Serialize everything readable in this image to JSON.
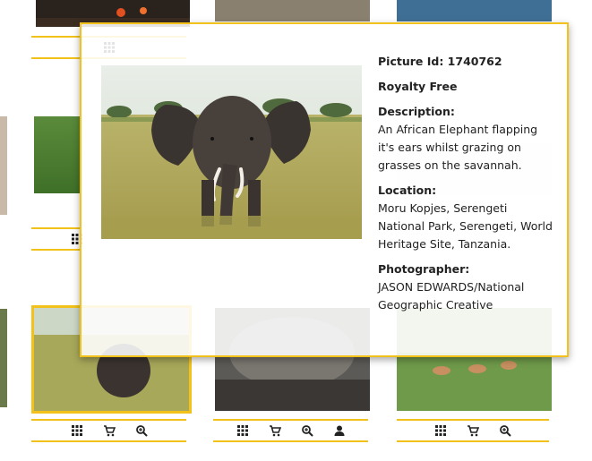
{
  "popup": {
    "picture_id_label": "Picture Id: 1740762",
    "license": "Royalty Free",
    "description_heading": "Description:",
    "description": "An African Elephant flapping it's ears whilst grazing on grasses on the savannah.",
    "location_heading": "Location:",
    "location": "Moru Kopjes, Serengeti National Park, Serengeti, World Heritage Site, Tanzania.",
    "photographer_heading": "Photographer:",
    "photographer": "JASON EDWARDS/National Geographic Creative"
  },
  "colors": {
    "accent": "#f2c21a"
  },
  "icons": [
    "grid-icon",
    "cart-icon",
    "zoom-icon",
    "user-icon"
  ]
}
